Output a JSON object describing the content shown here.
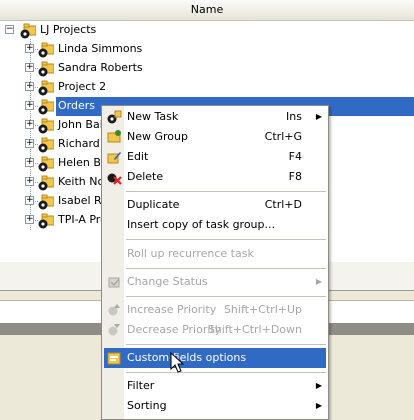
{
  "header": {
    "name_column": "Name"
  },
  "tree": {
    "root": "LJ Projects",
    "children": [
      "Linda Simmons",
      "Sandra Roberts",
      "Project 2",
      "Orders",
      "John Bail",
      "Richard V",
      "Helen Bo",
      "Keith Nor",
      "Isabel Ri",
      "TPI-A Pro"
    ],
    "selected_index": 3
  },
  "menu": {
    "new_task": {
      "label": "New Task",
      "shortcut": "Ins"
    },
    "new_group": {
      "label": "New Group",
      "shortcut": "Ctrl+G"
    },
    "edit": {
      "label": "Edit",
      "shortcut": "F4"
    },
    "delete": {
      "label": "Delete",
      "shortcut": "F8"
    },
    "duplicate": {
      "label": "Duplicate",
      "shortcut": "Ctrl+D"
    },
    "insert_copy": {
      "label": "Insert copy of task group..."
    },
    "roll_up": {
      "label": "Roll up recurrence task"
    },
    "change_status": {
      "label": "Change Status"
    },
    "increase_priority": {
      "label": "Increase Priority",
      "shortcut": "Shift+Ctrl+Up"
    },
    "decrease_priority": {
      "label": "Decrease Priority",
      "shortcut": "Shift+Ctrl+Down"
    },
    "custom_fields": {
      "label": "Custom fields options"
    },
    "filter": {
      "label": "Filter"
    },
    "sorting": {
      "label": "Sorting"
    }
  },
  "colors": {
    "selection": "#316ac5",
    "folder": "#f2c64a",
    "gear": "#1a1a1a"
  },
  "icons": {
    "tree_node": "folder-gear-icon",
    "submenu": "arrow-right-icon"
  }
}
